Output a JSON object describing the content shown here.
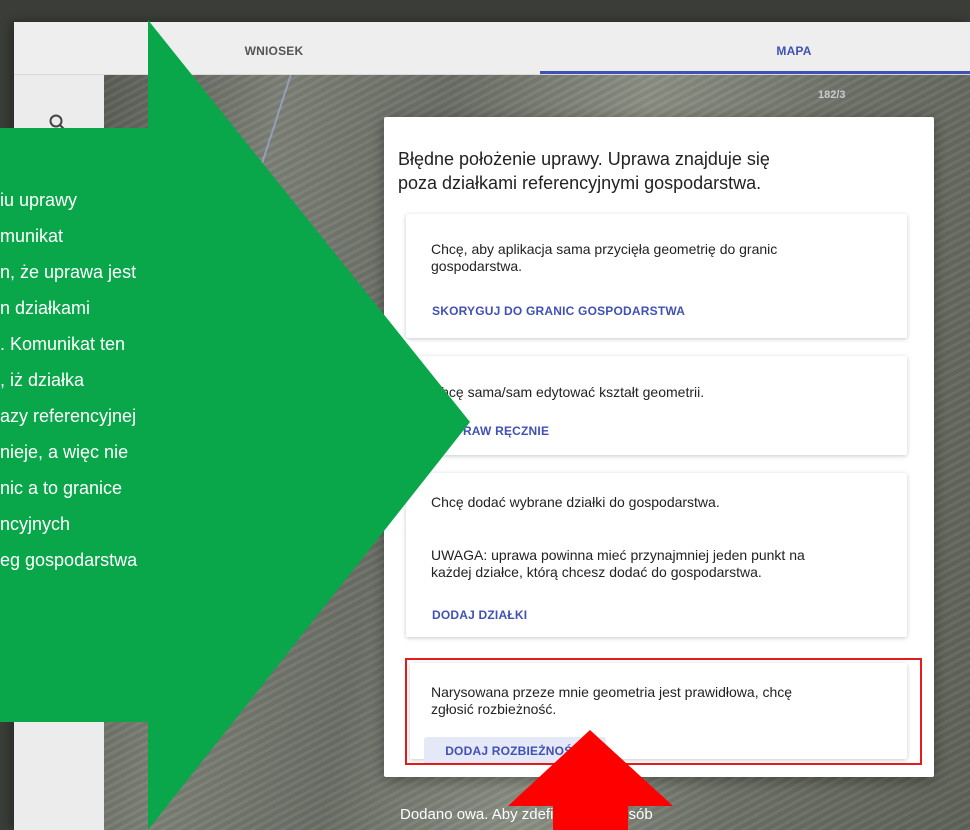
{
  "tabs": [
    {
      "label": "WNIOSEK",
      "active": false
    },
    {
      "label": "MAPA",
      "active": true
    }
  ],
  "map": {
    "parcel_label": "182/3"
  },
  "dialog": {
    "title_line1": "Błędne położenie uprawy. Uprawa znajduje się",
    "title_line2": "poza działkami referencyjnymi gospodarstwa.",
    "options": [
      {
        "text_line1": "Chcę, aby aplikacja sama przycięła geometrię do granic",
        "text_line2": "gospodarstwa.",
        "button": "SKORYGUJ DO GRANIC GOSPODARSTWA"
      },
      {
        "text_line1": "Chcę sama/sam edytować kształt geometrii.",
        "button": "POPRAW RĘCZNIE"
      },
      {
        "text_line1": "Chcę dodać wybrane działki do gospodarstwa.",
        "warning_line1": "UWAGA: uprawa powinna mieć przynajmniej jeden punkt na",
        "warning_line2": "każdej działce, którą chcesz dodać do gospodarstwa.",
        "button": "DODAJ DZIAŁKI"
      },
      {
        "text_line1": "Narysowana przeze mnie geometria jest prawidłowa, chcę",
        "text_line2": "zgłosić rozbieżność.",
        "button": "DODAJ ROZBIEŻNOŚCI"
      }
    ]
  },
  "footer_text": "Dodano                             owa. Aby zdefiniować sposób",
  "callout_lines": [
    "iu uprawy",
    "munikat",
    "n, że uprawa jest",
    "n działkami",
    ". Komunikat ten",
    ", iż działka",
    "azy referencyjnej",
    "nieje, a więc nie",
    "nic a to granice",
    "ncyjnych",
    "eg gospodarstwa"
  ],
  "colors": {
    "accent": "#3f51b5",
    "arrow_green": "#0aa64a",
    "highlight_red": "#e31b1b"
  }
}
